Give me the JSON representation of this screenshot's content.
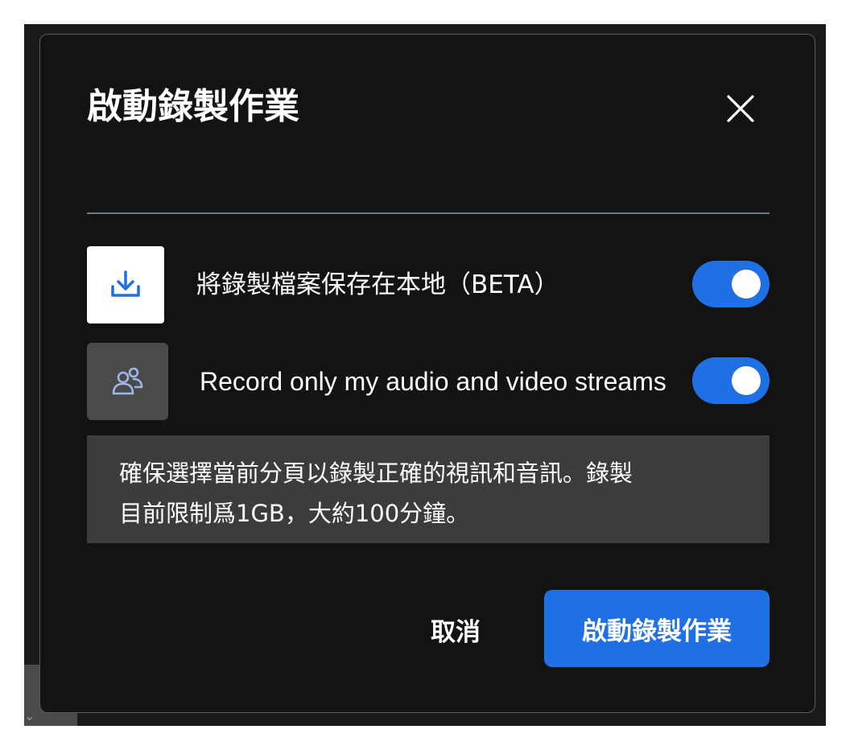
{
  "dialog": {
    "title": "啟動錄製作業",
    "close_icon": "close-icon"
  },
  "options": [
    {
      "icon": "download-icon",
      "label": "將錄製檔案保存在本地（BETA）",
      "enabled": true
    },
    {
      "icon": "people-icon",
      "label": "Record only my audio and video streams",
      "enabled": true
    }
  ],
  "notice": {
    "line1": "確保選擇當前分頁以錄製正確的視訊和音訊。錄製",
    "line2": "目前限制爲1GB，大約100分鐘。"
  },
  "actions": {
    "cancel_label": "取消",
    "start_label": "啟動錄製作業"
  },
  "colors": {
    "accent": "#1f6fe5",
    "dialog_bg": "#131313",
    "notice_bg": "#3c3c3c",
    "divider": "#6b7a88"
  }
}
